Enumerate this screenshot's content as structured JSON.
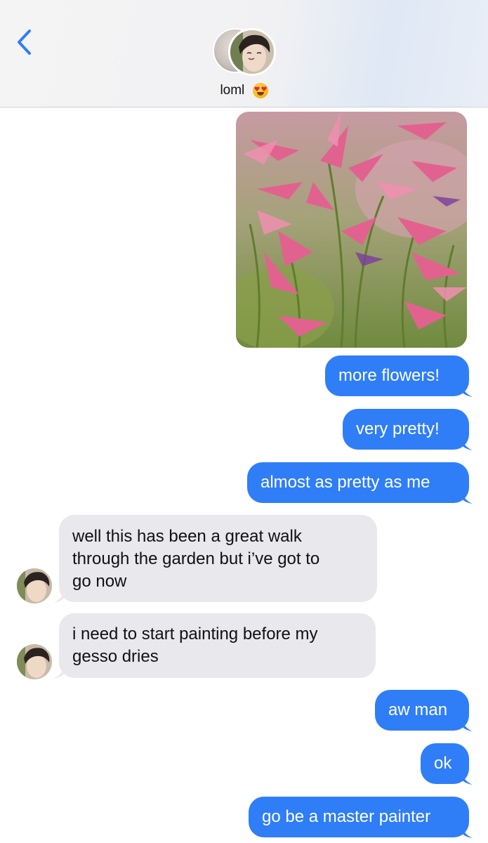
{
  "header": {
    "contact_name": "loml",
    "emoji_icon": "heart-eyes-emoji-icon",
    "back_icon": "chevron-left-icon"
  },
  "colors": {
    "outgoing_bubble": "#2f7ef7",
    "incoming_bubble": "#e8e8ed",
    "accent": "#2f7ef7"
  },
  "messages": [
    {
      "direction": "out",
      "type": "image",
      "alt": "pink flowers photo"
    },
    {
      "direction": "out",
      "text": "more flowers!"
    },
    {
      "direction": "out",
      "text": "very pretty!"
    },
    {
      "direction": "out",
      "text": "almost as pretty as me"
    },
    {
      "direction": "in",
      "lines": [
        "well this has been a great walk",
        "through the garden but i’ve got to",
        "go now"
      ]
    },
    {
      "direction": "in",
      "lines": [
        "i need to start painting before my",
        "gesso dries"
      ]
    },
    {
      "direction": "out",
      "text": "aw man"
    },
    {
      "direction": "out",
      "text": "ok"
    },
    {
      "direction": "out",
      "text": "go be a master painter"
    }
  ]
}
